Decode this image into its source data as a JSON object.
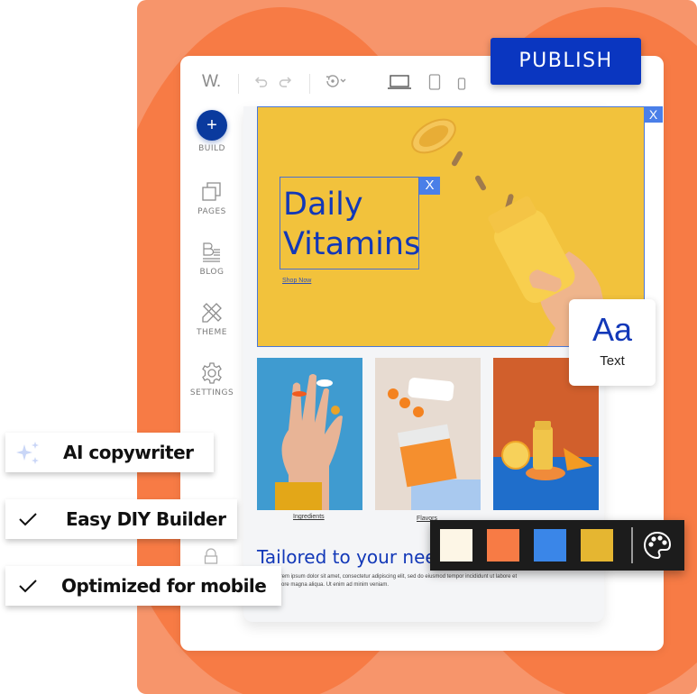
{
  "editor": {
    "logo": "W.",
    "toolbar": {
      "icons": [
        "undo-icon",
        "redo-icon",
        "history-icon",
        "desktop-icon",
        "tablet-icon",
        "mobile-icon"
      ]
    },
    "publish_label": "PUBLISH",
    "sidebar": {
      "items": [
        {
          "label": "BUILD",
          "icon": "plus-icon"
        },
        {
          "label": "PAGES",
          "icon": "pages-icon"
        },
        {
          "label": "BLOG",
          "icon": "blog-icon"
        },
        {
          "label": "THEME",
          "icon": "theme-icon"
        },
        {
          "label": "SETTINGS",
          "icon": "gear-icon"
        }
      ]
    }
  },
  "hero": {
    "title_line1": "Daily",
    "title_line2": "Vitamins",
    "close_label": "X",
    "cta": "Shop Now"
  },
  "products": [
    {
      "caption": "Ingredients"
    },
    {
      "caption": "Flavors"
    },
    {
      "caption": ""
    }
  ],
  "section": {
    "title": "Tailored to your needs",
    "body": "Lorem ipsum dolor sit amet, consectetur adipiscing elit, sed do eiusmod tempor incididunt ut labore et dolore magna aliqua. Ut enim ad minim veniam."
  },
  "text_widget": {
    "glyph": "Aa",
    "label": "Text"
  },
  "palette": {
    "colors": [
      "#fdf6e6",
      "#f77b45",
      "#3a86e8",
      "#e5b631"
    ],
    "icon": "palette-icon"
  },
  "features": [
    {
      "label": "AI copywriter",
      "icon": "sparkle-icon"
    },
    {
      "label": "Easy DIY Builder",
      "icon": "check-icon"
    },
    {
      "label": "Optimized for mobile",
      "icon": "check-icon"
    }
  ]
}
